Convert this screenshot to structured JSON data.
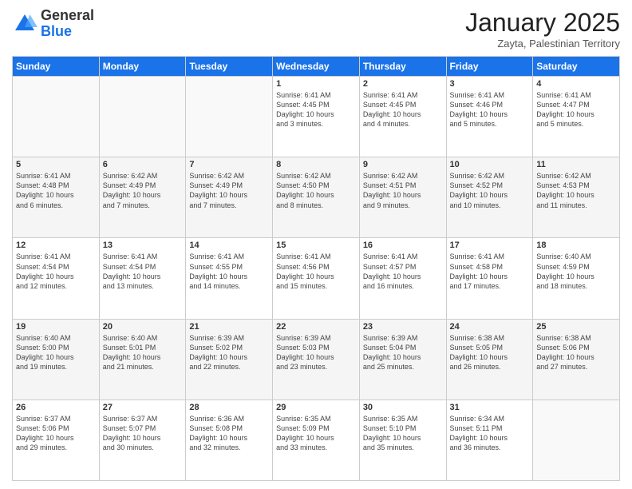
{
  "logo": {
    "general": "General",
    "blue": "Blue"
  },
  "header": {
    "title": "January 2025",
    "subtitle": "Zayta, Palestinian Territory"
  },
  "days": [
    "Sunday",
    "Monday",
    "Tuesday",
    "Wednesday",
    "Thursday",
    "Friday",
    "Saturday"
  ],
  "weeks": [
    [
      {
        "day": "",
        "info": ""
      },
      {
        "day": "",
        "info": ""
      },
      {
        "day": "",
        "info": ""
      },
      {
        "day": "1",
        "info": "Sunrise: 6:41 AM\nSunset: 4:45 PM\nDaylight: 10 hours\nand 3 minutes."
      },
      {
        "day": "2",
        "info": "Sunrise: 6:41 AM\nSunset: 4:45 PM\nDaylight: 10 hours\nand 4 minutes."
      },
      {
        "day": "3",
        "info": "Sunrise: 6:41 AM\nSunset: 4:46 PM\nDaylight: 10 hours\nand 5 minutes."
      },
      {
        "day": "4",
        "info": "Sunrise: 6:41 AM\nSunset: 4:47 PM\nDaylight: 10 hours\nand 5 minutes."
      }
    ],
    [
      {
        "day": "5",
        "info": "Sunrise: 6:41 AM\nSunset: 4:48 PM\nDaylight: 10 hours\nand 6 minutes."
      },
      {
        "day": "6",
        "info": "Sunrise: 6:42 AM\nSunset: 4:49 PM\nDaylight: 10 hours\nand 7 minutes."
      },
      {
        "day": "7",
        "info": "Sunrise: 6:42 AM\nSunset: 4:49 PM\nDaylight: 10 hours\nand 7 minutes."
      },
      {
        "day": "8",
        "info": "Sunrise: 6:42 AM\nSunset: 4:50 PM\nDaylight: 10 hours\nand 8 minutes."
      },
      {
        "day": "9",
        "info": "Sunrise: 6:42 AM\nSunset: 4:51 PM\nDaylight: 10 hours\nand 9 minutes."
      },
      {
        "day": "10",
        "info": "Sunrise: 6:42 AM\nSunset: 4:52 PM\nDaylight: 10 hours\nand 10 minutes."
      },
      {
        "day": "11",
        "info": "Sunrise: 6:42 AM\nSunset: 4:53 PM\nDaylight: 10 hours\nand 11 minutes."
      }
    ],
    [
      {
        "day": "12",
        "info": "Sunrise: 6:41 AM\nSunset: 4:54 PM\nDaylight: 10 hours\nand 12 minutes."
      },
      {
        "day": "13",
        "info": "Sunrise: 6:41 AM\nSunset: 4:54 PM\nDaylight: 10 hours\nand 13 minutes."
      },
      {
        "day": "14",
        "info": "Sunrise: 6:41 AM\nSunset: 4:55 PM\nDaylight: 10 hours\nand 14 minutes."
      },
      {
        "day": "15",
        "info": "Sunrise: 6:41 AM\nSunset: 4:56 PM\nDaylight: 10 hours\nand 15 minutes."
      },
      {
        "day": "16",
        "info": "Sunrise: 6:41 AM\nSunset: 4:57 PM\nDaylight: 10 hours\nand 16 minutes."
      },
      {
        "day": "17",
        "info": "Sunrise: 6:41 AM\nSunset: 4:58 PM\nDaylight: 10 hours\nand 17 minutes."
      },
      {
        "day": "18",
        "info": "Sunrise: 6:40 AM\nSunset: 4:59 PM\nDaylight: 10 hours\nand 18 minutes."
      }
    ],
    [
      {
        "day": "19",
        "info": "Sunrise: 6:40 AM\nSunset: 5:00 PM\nDaylight: 10 hours\nand 19 minutes."
      },
      {
        "day": "20",
        "info": "Sunrise: 6:40 AM\nSunset: 5:01 PM\nDaylight: 10 hours\nand 21 minutes."
      },
      {
        "day": "21",
        "info": "Sunrise: 6:39 AM\nSunset: 5:02 PM\nDaylight: 10 hours\nand 22 minutes."
      },
      {
        "day": "22",
        "info": "Sunrise: 6:39 AM\nSunset: 5:03 PM\nDaylight: 10 hours\nand 23 minutes."
      },
      {
        "day": "23",
        "info": "Sunrise: 6:39 AM\nSunset: 5:04 PM\nDaylight: 10 hours\nand 25 minutes."
      },
      {
        "day": "24",
        "info": "Sunrise: 6:38 AM\nSunset: 5:05 PM\nDaylight: 10 hours\nand 26 minutes."
      },
      {
        "day": "25",
        "info": "Sunrise: 6:38 AM\nSunset: 5:06 PM\nDaylight: 10 hours\nand 27 minutes."
      }
    ],
    [
      {
        "day": "26",
        "info": "Sunrise: 6:37 AM\nSunset: 5:06 PM\nDaylight: 10 hours\nand 29 minutes."
      },
      {
        "day": "27",
        "info": "Sunrise: 6:37 AM\nSunset: 5:07 PM\nDaylight: 10 hours\nand 30 minutes."
      },
      {
        "day": "28",
        "info": "Sunrise: 6:36 AM\nSunset: 5:08 PM\nDaylight: 10 hours\nand 32 minutes."
      },
      {
        "day": "29",
        "info": "Sunrise: 6:35 AM\nSunset: 5:09 PM\nDaylight: 10 hours\nand 33 minutes."
      },
      {
        "day": "30",
        "info": "Sunrise: 6:35 AM\nSunset: 5:10 PM\nDaylight: 10 hours\nand 35 minutes."
      },
      {
        "day": "31",
        "info": "Sunrise: 6:34 AM\nSunset: 5:11 PM\nDaylight: 10 hours\nand 36 minutes."
      },
      {
        "day": "",
        "info": ""
      }
    ]
  ]
}
